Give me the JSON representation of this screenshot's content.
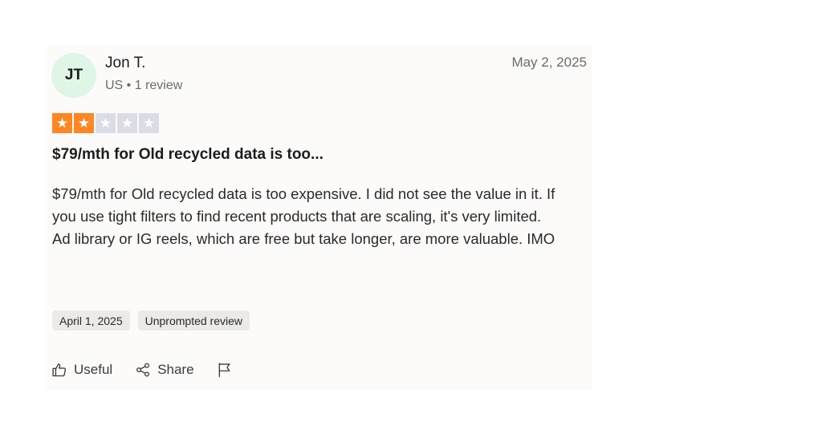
{
  "reviewer": {
    "initials": "JT",
    "name": "Jon T.",
    "meta": "US • 1 review",
    "date": "May 2, 2025"
  },
  "rating": {
    "value": 2,
    "max": 5,
    "on_color": "#ff8622",
    "off_color": "#dcdce6"
  },
  "review": {
    "title": "$79/mth for Old recycled data is too...",
    "paragraphs": [
      "$79/mth for Old recycled data is too expensive. I did not see the value in it. If you use tight filters to find recent products that are scaling, it's very limited.",
      "Ad library or IG reels, which are free but take longer, are more valuable. IMO"
    ]
  },
  "chips": {
    "experience_date": "April 1, 2025",
    "review_type": "Unprompted review"
  },
  "actions": {
    "useful_label": "Useful",
    "useful_icon": "thumbs-up-icon",
    "share_label": "Share",
    "share_icon": "share-icon",
    "flag_icon": "flag-icon"
  }
}
